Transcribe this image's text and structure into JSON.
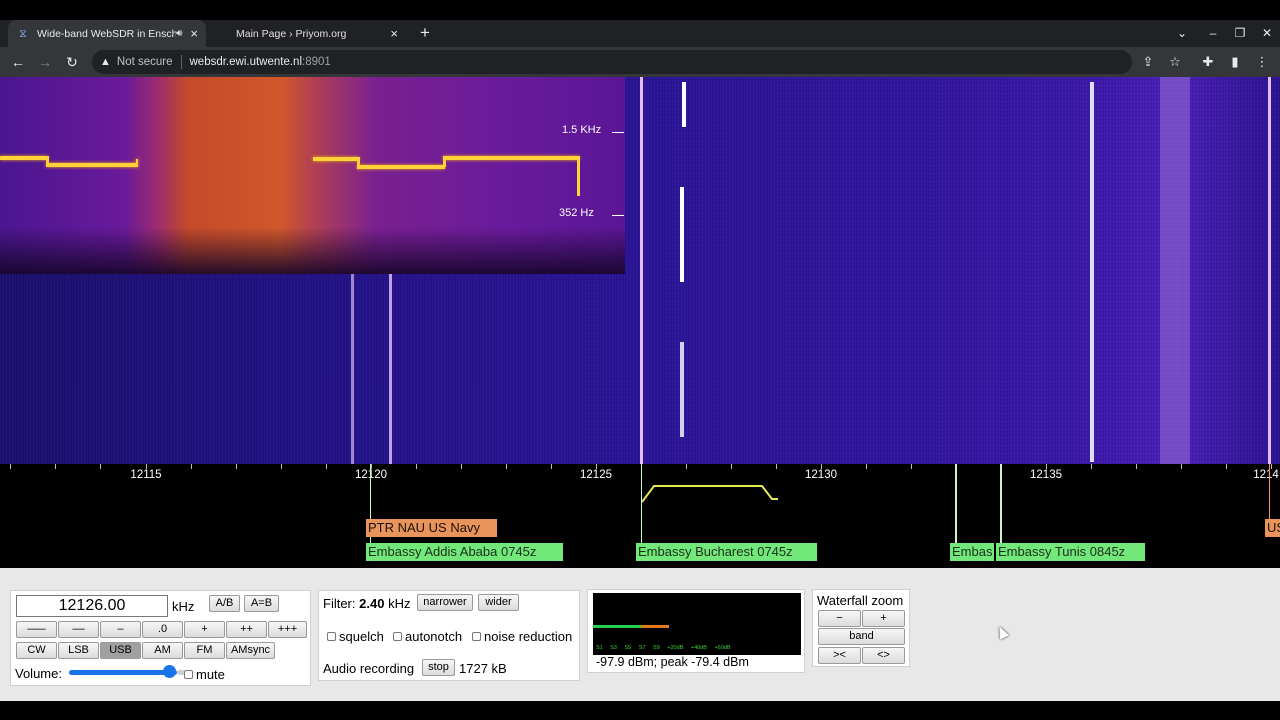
{
  "browser": {
    "tabs": [
      {
        "title": "Wide-band WebSDR in Ensch",
        "active": true
      },
      {
        "title": "Main Page › Priyom.org",
        "active": false
      }
    ],
    "address": {
      "security": "Not secure",
      "host": "websdr.ewi.utwente.nl",
      "port": ":8901"
    }
  },
  "spectrogram": {
    "labels": [
      "1.5  KHz",
      "352  Hz"
    ]
  },
  "scale": {
    "labels": [
      "12115",
      "12120",
      "12125",
      "12130",
      "12135",
      "1214"
    ]
  },
  "stations": [
    {
      "label": "PTR NAU US Navy",
      "color": "#e8945a"
    },
    {
      "label": "Embassy Addis Ababa 0745z",
      "color": "#73e87a"
    },
    {
      "label": "Embassy Bucharest 0745z",
      "color": "#73e87a"
    },
    {
      "label": "Embas",
      "color": "#73e87a"
    },
    {
      "label": "Embassy Tunis 0845z",
      "color": "#73e87a"
    },
    {
      "label": "US",
      "color": "#e8945a"
    }
  ],
  "tuning": {
    "frequency": "12126.00",
    "unit": "kHz",
    "ab": "A/B",
    "aeqb": "A=B",
    "steps": [
      "–––",
      "––",
      "–",
      ".0",
      "+",
      "++",
      "+++"
    ],
    "modes": [
      "CW",
      "LSB",
      "USB",
      "AM",
      "FM",
      "AMsync"
    ],
    "selected_mode": "USB",
    "volume_label": "Volume:",
    "volume_level": 0.85,
    "mute": "mute"
  },
  "filter": {
    "label": "Filter:",
    "value": "2.40",
    "unit": "kHz",
    "narrower": "narrower",
    "wider": "wider",
    "squelch": "squelch",
    "autonotch": "autonotch",
    "noise_reduction": "noise reduction",
    "recording_label": "Audio recording",
    "stop": "stop",
    "size": "1727 kB"
  },
  "smeter": {
    "scale": "S1 S3 S5 S7 S9 +20dB +40dB +60dB",
    "reading": "-97.9 dBm; peak  -79.4 dBm"
  },
  "waterfall_zoom": {
    "title": "Waterfall zoom",
    "minus": "−",
    "plus": "+",
    "band": "band",
    "narrow": "><",
    "wide": "<>"
  }
}
